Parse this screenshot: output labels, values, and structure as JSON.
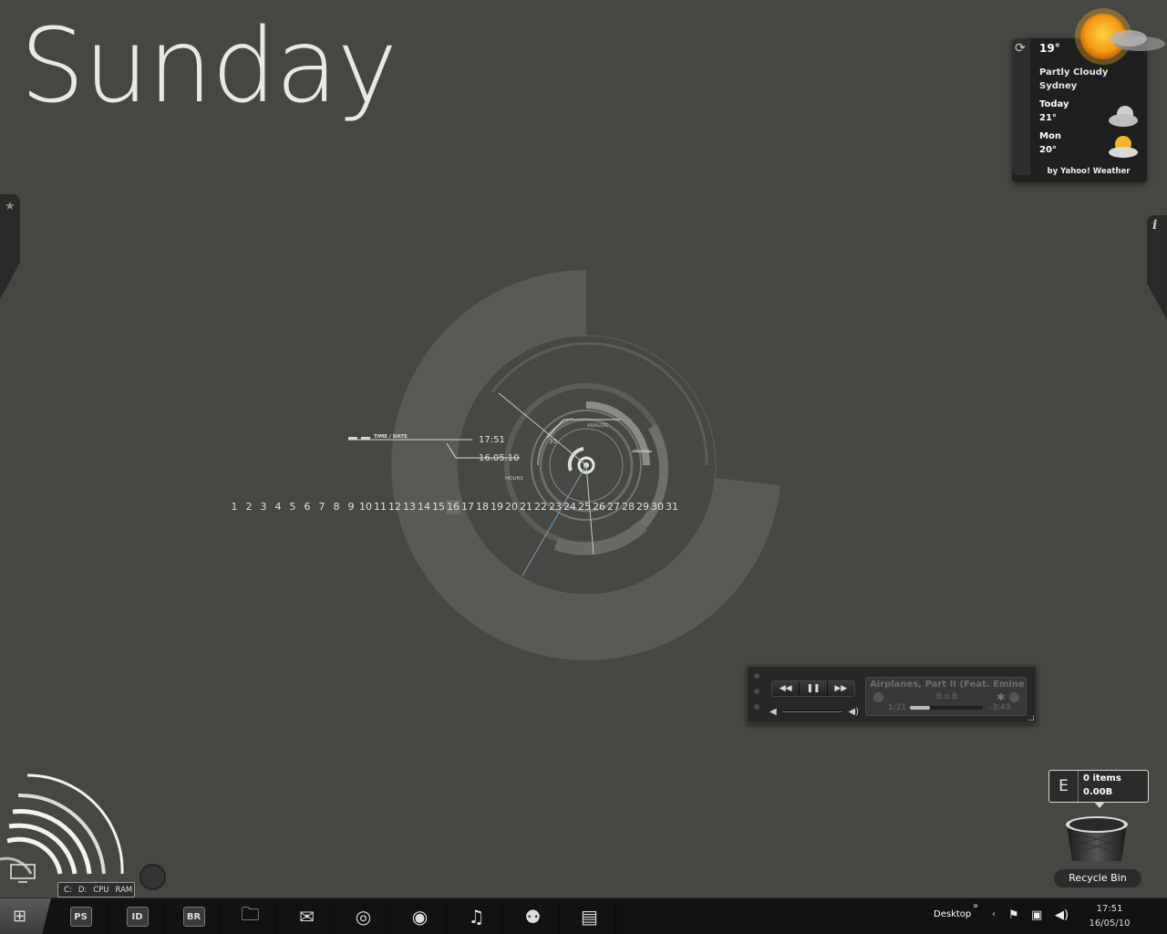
{
  "desktop": {
    "day": "Sunday"
  },
  "weather": {
    "temperature": "19°",
    "condition": "Partly Cloudy",
    "city": "Sydney",
    "forecast": [
      {
        "day": "Today",
        "temp": "21°"
      },
      {
        "day": "Mon",
        "temp": "20°"
      }
    ],
    "credit": "by Yahoo! Weather"
  },
  "clock": {
    "label": "TIME / DATE",
    "time": "17:51",
    "date": "16.05.10",
    "analog_label": "ANALOG",
    "seconds_value": "35",
    "hours_label": "HOURS",
    "minutes_label": "MINUTES"
  },
  "calendar": {
    "days": [
      "1",
      "2",
      "3",
      "4",
      "5",
      "6",
      "7",
      "8",
      "9",
      "10",
      "11",
      "12",
      "13",
      "14",
      "15",
      "16",
      "17",
      "18",
      "19",
      "20",
      "21",
      "22",
      "23",
      "24",
      "25",
      "26",
      "27",
      "28",
      "29",
      "30",
      "31"
    ],
    "today": "16"
  },
  "player": {
    "track": "Airplanes, Part II (Feat. Eminem",
    "artist": "B.o.B",
    "elapsed": "1:21",
    "remaining": "-3:49",
    "progress": 0.27
  },
  "drive": {
    "letter": "E",
    "items": "0 items",
    "size": "0.00B"
  },
  "recycle_bin": {
    "label": "Recycle Bin"
  },
  "system_gauge": {
    "labels": [
      "C:",
      "D:",
      "CPU",
      "RAM"
    ]
  },
  "taskbar": {
    "apps": [
      {
        "label": "PS",
        "icon": "photoshop-icon"
      },
      {
        "label": "ID",
        "icon": "indesign-icon"
      },
      {
        "label": "BR",
        "icon": "bridge-icon"
      },
      {
        "label": "",
        "icon": "folder-icon"
      },
      {
        "label": "",
        "icon": "mail-icon"
      },
      {
        "label": "",
        "icon": "chrome-icon"
      },
      {
        "label": "",
        "icon": "firefox-icon"
      },
      {
        "label": "",
        "icon": "music-icon"
      },
      {
        "label": "",
        "icon": "messenger-icon"
      },
      {
        "label": "",
        "icon": "notes-icon"
      }
    ],
    "desktop_label": "Desktop",
    "time": "17:51",
    "date": "16/05/10"
  }
}
